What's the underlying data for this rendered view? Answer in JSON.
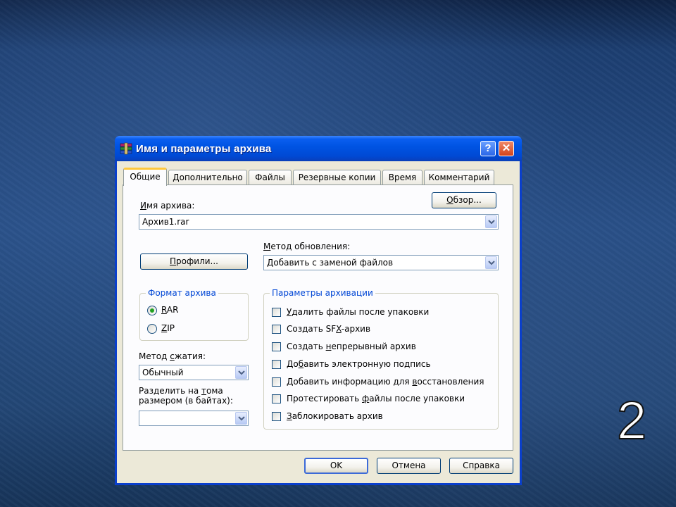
{
  "slide_number": "2",
  "window": {
    "title": "Имя и параметры архива",
    "help_glyph": "?",
    "close_glyph": "✕"
  },
  "tabs": [
    {
      "label": "Общие",
      "active": true
    },
    {
      "label": "Дополнительно",
      "active": false
    },
    {
      "label": "Файлы",
      "active": false
    },
    {
      "label": "Резервные копии",
      "active": false
    },
    {
      "label": "Время",
      "active": false
    },
    {
      "label": "Комментарий",
      "active": false
    }
  ],
  "archive_name": {
    "label_u": "И",
    "label_rest": "мя архива:",
    "value": "Архив1.rar"
  },
  "browse_button": {
    "label_u": "О",
    "label_rest": "бзор..."
  },
  "update_method": {
    "label_u": "М",
    "label_rest": "етод обновления:",
    "value": "Добавить с заменой файлов"
  },
  "profiles_button": {
    "label_u": "П",
    "label_rest": "рофили..."
  },
  "archive_format": {
    "title": "Формат архива",
    "options": [
      {
        "label_u": "R",
        "label_rest": "AR",
        "checked": true
      },
      {
        "label_u": "Z",
        "label_rest": "IP",
        "checked": false
      }
    ]
  },
  "compression": {
    "label_pre": "Метод ",
    "label_u": "с",
    "label_rest": "жатия:",
    "value": "Обычный"
  },
  "split": {
    "line1_pre": "Разделить на ",
    "line1_u": "т",
    "line1_rest": "ома",
    "line2": "размером (в байтах):",
    "value": ""
  },
  "archive_options": {
    "title": "Параметры архивации",
    "items": [
      {
        "pre": "",
        "u": "У",
        "rest": "далить файлы после упаковки",
        "checked": false
      },
      {
        "pre": "Создать SF",
        "u": "X",
        "rest": "-архив",
        "checked": false
      },
      {
        "pre": "Создать ",
        "u": "н",
        "rest": "епрерывный архив",
        "checked": false
      },
      {
        "pre": "До",
        "u": "б",
        "rest": "авить электронную подпись",
        "checked": false
      },
      {
        "pre": "Добавить информацию для ",
        "u": "в",
        "rest": "осстановления",
        "checked": false
      },
      {
        "pre": "Протестировать ",
        "u": "ф",
        "rest": "айлы после упаковки",
        "checked": false
      },
      {
        "pre": "",
        "u": "З",
        "rest": "аблокировать архив",
        "checked": false
      }
    ]
  },
  "buttons": {
    "ok": "OK",
    "cancel": "Отмена",
    "help": "Справка"
  },
  "colors": {
    "titlebar": "#0054e3",
    "group_title": "#0046d5",
    "dialog_face": "#ece9d8",
    "active_tab_accent": "#ffc83c"
  }
}
